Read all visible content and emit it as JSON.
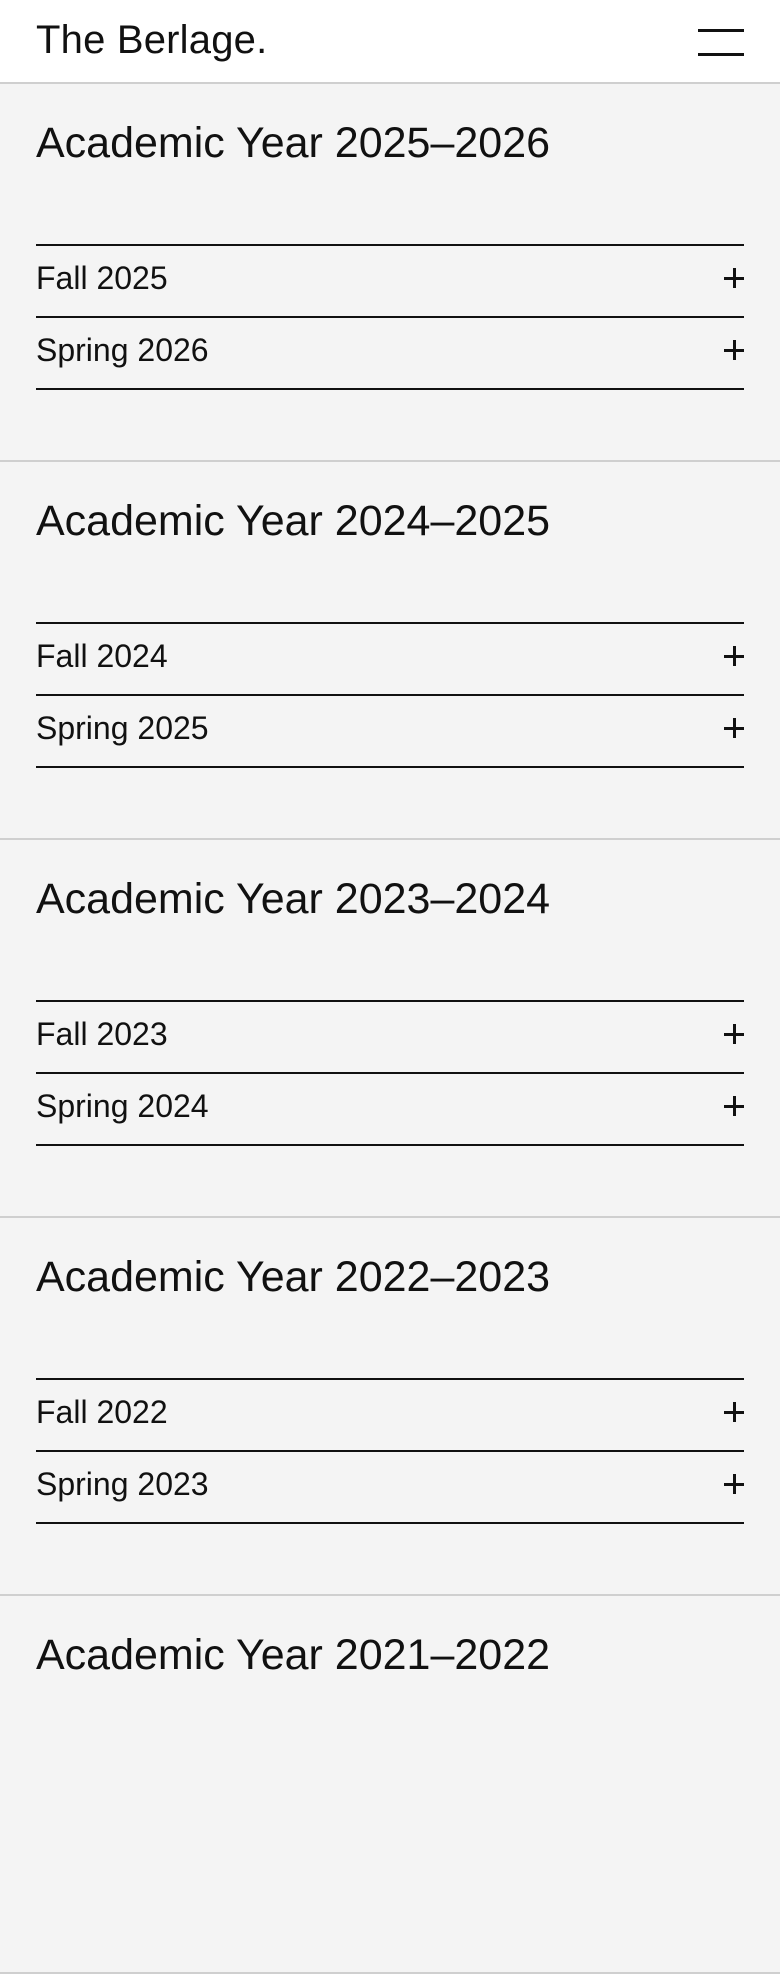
{
  "header": {
    "brand": "The Berlage.",
    "menu_icon": "hamburger-menu-icon"
  },
  "years": [
    {
      "title": "Academic Year 2025–2026",
      "terms": [
        {
          "label": "Fall 2025",
          "icon": "plus-icon"
        },
        {
          "label": "Spring 2026",
          "icon": "plus-icon"
        }
      ]
    },
    {
      "title": "Academic Year 2024–2025",
      "terms": [
        {
          "label": "Fall 2024",
          "icon": "plus-icon"
        },
        {
          "label": "Spring 2025",
          "icon": "plus-icon"
        }
      ]
    },
    {
      "title": "Academic Year 2023–2024",
      "terms": [
        {
          "label": "Fall 2023",
          "icon": "plus-icon"
        },
        {
          "label": "Spring 2024",
          "icon": "plus-icon"
        }
      ]
    },
    {
      "title": "Academic Year 2022–2023",
      "terms": [
        {
          "label": "Fall 2022",
          "icon": "plus-icon"
        },
        {
          "label": "Spring 2023",
          "icon": "plus-icon"
        }
      ]
    },
    {
      "title": "Academic Year 2021–2022",
      "terms": []
    }
  ],
  "colors": {
    "background": "#f4f4f4",
    "header_background": "#ffffff",
    "text": "#111111",
    "section_divider": "#cfcfcf"
  }
}
